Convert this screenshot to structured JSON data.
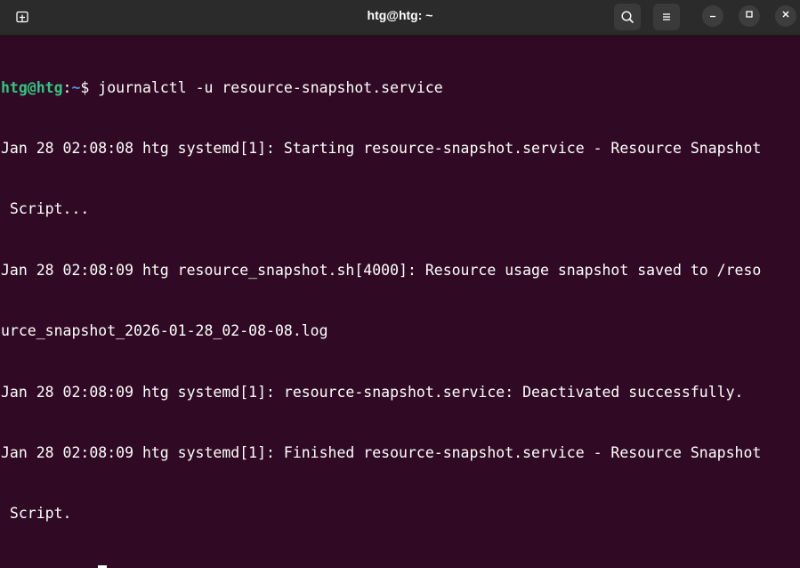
{
  "window": {
    "title": "htg@htg: ~"
  },
  "prompt": {
    "user_host": "htg@htg",
    "separator": ":",
    "path": "~",
    "symbol": "$ "
  },
  "terminal": {
    "command": "journalctl -u resource-snapshot.service",
    "output_lines": [
      "Jan 28 02:08:08 htg systemd[1]: Starting resource-snapshot.service - Resource Snapshot",
      " Script...",
      "Jan 28 02:08:09 htg resource_snapshot.sh[4000]: Resource usage snapshot saved to /reso",
      "urce_snapshot_2026-01-28_02-08-08.log",
      "Jan 28 02:08:09 htg systemd[1]: resource-snapshot.service: Deactivated successfully.",
      "Jan 28 02:08:09 htg systemd[1]: Finished resource-snapshot.service - Resource Snapshot",
      " Script."
    ]
  },
  "icons": {
    "new_tab": "new-tab-icon",
    "search": "search-icon",
    "menu": "hamburger-menu-icon",
    "minimize": "minimize-icon",
    "maximize": "maximize-icon",
    "close": "close-icon"
  },
  "colors": {
    "background": "#300a24",
    "prompt_user": "#33c480",
    "prompt_path": "#5c8fd6",
    "titlebar": "#2b2b2b"
  }
}
